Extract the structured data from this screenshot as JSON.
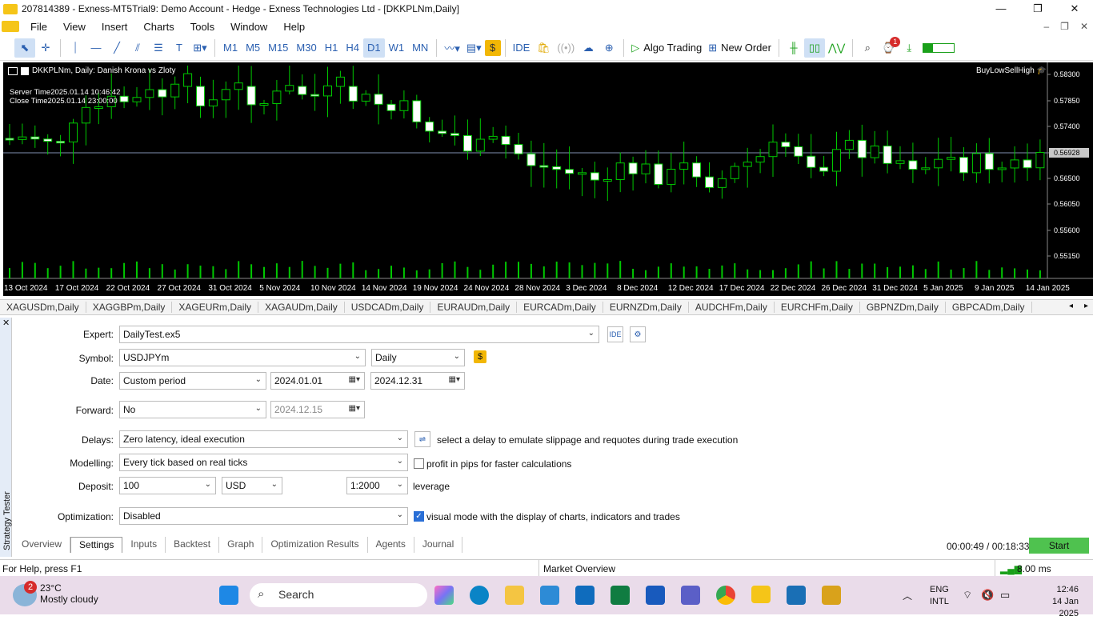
{
  "window": {
    "title": "207814389 - Exness-MT5Trial9: Demo Account - Hedge - Exness Technologies Ltd - [DKKPLNm,Daily]",
    "minimize": "—",
    "restore": "❐",
    "close": "✕"
  },
  "menu": {
    "items": [
      "File",
      "View",
      "Insert",
      "Charts",
      "Tools",
      "Window",
      "Help"
    ]
  },
  "toolbar": {
    "timeframes": [
      "M1",
      "M5",
      "M15",
      "M30",
      "H1",
      "H4",
      "D1",
      "W1",
      "MN"
    ],
    "active_timeframe": "D1",
    "ide": "IDE",
    "algo_trading": "Algo Trading",
    "new_order": "New Order",
    "notification_count": "1"
  },
  "chart": {
    "header": "DKKPLNm, Daily:  Danish Krona vs Zloty",
    "server_time": "Server Time2025.01.14 10:46:42",
    "close_time": "Close Time2025.01.14 23:00:00",
    "ea_label": "BuyLowSellHigh",
    "price_labels": [
      "0.58300",
      "0.57850",
      "0.57400",
      "0.56928",
      "0.56500",
      "0.56050",
      "0.55600",
      "0.55150"
    ],
    "current_price": "0.56928",
    "date_labels": [
      "13 Oct 2024",
      "17 Oct 2024",
      "22 Oct 2024",
      "27 Oct 2024",
      "31 Oct 2024",
      "5 Nov 2024",
      "10 Nov 2024",
      "14 Nov 2024",
      "19 Nov 2024",
      "24 Nov 2024",
      "28 Nov 2024",
      "3 Dec 2024",
      "8 Dec 2024",
      "12 Dec 2024",
      "17 Dec 2024",
      "22 Dec 2024",
      "26 Dec 2024",
      "31 Dec 2024",
      "5 Jan 2025",
      "9 Jan 2025",
      "14 Jan 2025"
    ],
    "colors": {
      "background": "#000000",
      "bull": "#00c800",
      "bear_fill": "#ffffff",
      "grid": "#3a3a3a",
      "price_line": "#8090b0"
    }
  },
  "symbol_tabs": [
    "XAGUSDm,Daily",
    "XAGGBPm,Daily",
    "XAGEURm,Daily",
    "XAGAUDm,Daily",
    "USDCADm,Daily",
    "EURAUDm,Daily",
    "EURCADm,Daily",
    "EURNZDm,Daily",
    "AUDCHFm,Daily",
    "EURCHFm,Daily",
    "GBPNZDm,Daily",
    "GBPCADm,Daily"
  ],
  "tester": {
    "side_label": "Strategy Tester",
    "expert_label": "Expert:",
    "expert_value": "DailyTest.ex5",
    "ide": "IDE",
    "symbol_label": "Symbol:",
    "symbol_value": "USDJPYm",
    "period_value": "Daily",
    "date_label": "Date:",
    "date_mode": "Custom period",
    "date_from": "2024.01.01",
    "date_to": "2024.12.31",
    "forward_label": "Forward:",
    "forward_value": "No",
    "forward_date": "2024.12.15",
    "delays_label": "Delays:",
    "delays_value": "Zero latency, ideal execution",
    "delays_hint": "select a delay to emulate slippage and requotes during trade execution",
    "modelling_label": "Modelling:",
    "modelling_value": "Every tick based on real ticks",
    "profit_pips_label": "profit in pips for faster calculations",
    "deposit_label": "Deposit:",
    "deposit_value": "100",
    "currency_value": "USD",
    "leverage_value": "1:2000",
    "leverage_label": "leverage",
    "optimization_label": "Optimization:",
    "optimization_value": "Disabled",
    "visual_mode_label": "visual mode with the display of charts, indicators and trades",
    "tabs": [
      "Overview",
      "Settings",
      "Inputs",
      "Backtest",
      "Graph",
      "Optimization Results",
      "Agents",
      "Journal"
    ],
    "active_tab": "Settings",
    "timer": "00:00:49 / 00:18:33",
    "start": "Start"
  },
  "statusbar": {
    "help": "For Help, press F1",
    "market": "Market Overview",
    "ping": "8.00 ms"
  },
  "taskbar": {
    "weather_badge": "2",
    "temperature": "23°C",
    "weather": "Mostly cloudy",
    "search": "Search",
    "lang1": "ENG",
    "lang2": "INTL",
    "time": "12:46",
    "date": "14 Jan 2025"
  }
}
